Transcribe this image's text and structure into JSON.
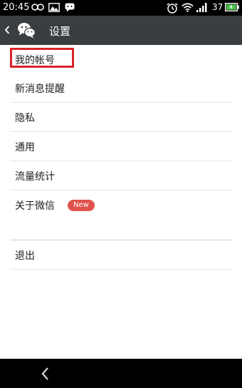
{
  "status_bar": {
    "time": "20:45",
    "battery_level": "37",
    "icons": [
      "infinity-icon",
      "image-icon",
      "chat-icon",
      "alarm-icon",
      "wifi-icon",
      "signal-icon",
      "battery-icon"
    ]
  },
  "title_bar": {
    "title": "设置",
    "icons": [
      "back-chevron-icon",
      "wechat-logo-icon"
    ]
  },
  "menu": {
    "items": [
      {
        "label": "我的帐号",
        "highlighted": true
      },
      {
        "label": "新消息提醒"
      },
      {
        "label": "隐私"
      },
      {
        "label": "通用"
      },
      {
        "label": "流量统计"
      },
      {
        "label": "关于微信",
        "badge": "New"
      }
    ],
    "logout_label": "退出"
  },
  "colors": {
    "title_bar_bg": "#3b3e41",
    "status_bar_bg": "#000000",
    "highlight_box": "#d9242a",
    "badge_bg": "#e0524d",
    "battery_fill": "#48c24b"
  }
}
